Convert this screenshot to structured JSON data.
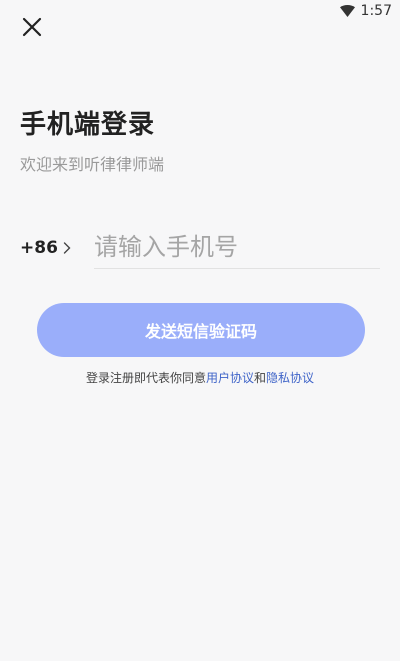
{
  "status_bar": {
    "time": "1:57",
    "wifi_icon": "wifi-icon"
  },
  "header": {
    "close_icon": "close-icon"
  },
  "login": {
    "title": "手机端登录",
    "subtitle": "欢迎来到听律律师端",
    "country_code": "+86",
    "phone_placeholder": "请输入手机号",
    "phone_value": "",
    "send_button_label": "发送短信验证码",
    "send_button_color": "#9aaefa"
  },
  "agreement": {
    "prefix": "登录注册即代表你同意",
    "user_agreement": "用户协议",
    "connector": "和",
    "privacy_agreement": "隐私协议",
    "link_color": "#3f64c8"
  }
}
